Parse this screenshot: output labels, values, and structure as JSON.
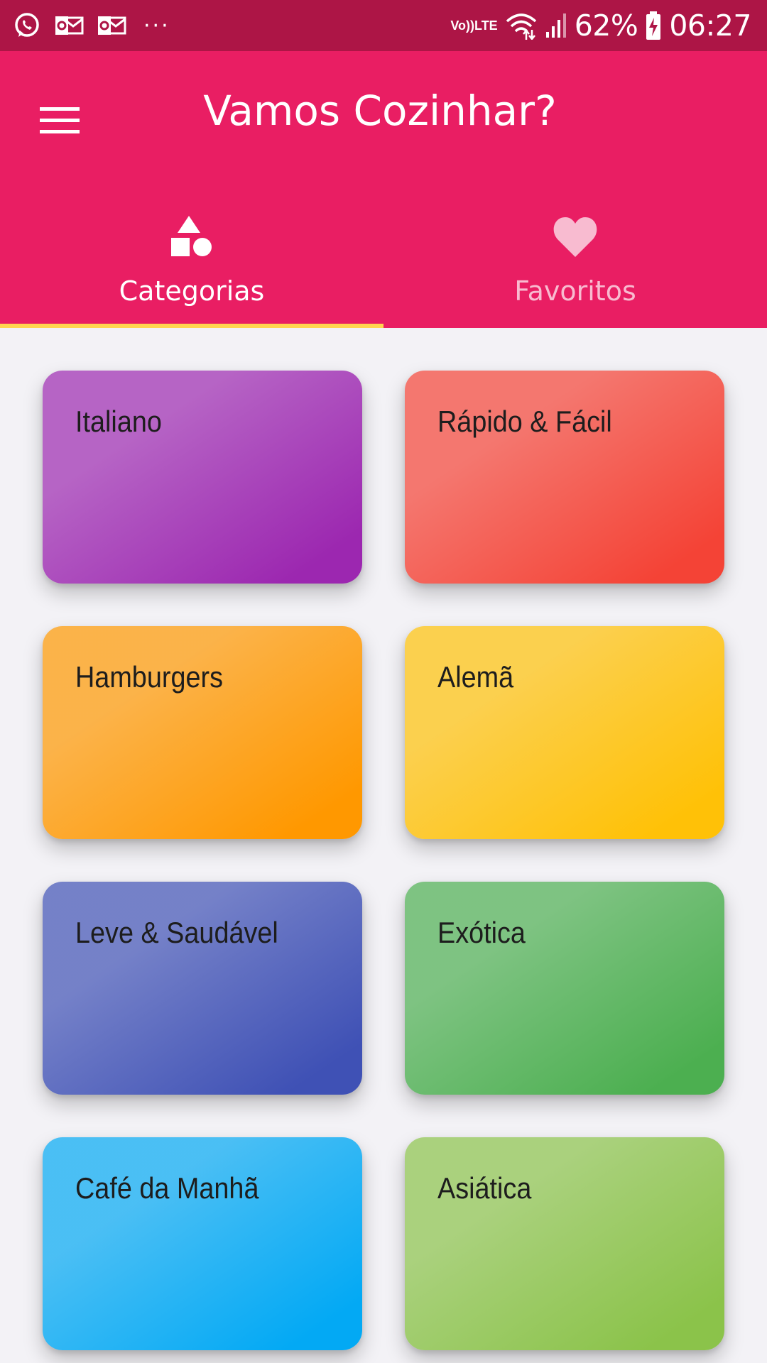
{
  "status_bar": {
    "battery": "62%",
    "time": "06:27",
    "volte_top": "Vo))",
    "volte_bottom": "LTE",
    "more": "···",
    "icons": [
      "whatsapp-icon",
      "outlook-icon",
      "outlook-icon",
      "volte-icon",
      "wifi-icon",
      "signal-icon",
      "battery-charging-icon"
    ]
  },
  "app_bar": {
    "title": "Vamos Cozinhar?",
    "menu_icon": "menu-icon",
    "background": "#e91e63"
  },
  "tabs": [
    {
      "label": "Categorias",
      "icon": "category-shapes-icon",
      "selected": true
    },
    {
      "label": "Favoritos",
      "icon": "heart-icon",
      "selected": false
    }
  ],
  "indicator_color": "#ffd54f",
  "categories": [
    {
      "label": "Italiano",
      "color": "#9c27b0"
    },
    {
      "label": "Rápido & Fácil",
      "color": "#f44336"
    },
    {
      "label": "Hamburgers",
      "color": "#ff9800"
    },
    {
      "label": "Alemã",
      "color": "#ffc107"
    },
    {
      "label": "Leve & Saudável",
      "color": "#3f51b5"
    },
    {
      "label": "Exótica",
      "color": "#4caf50"
    },
    {
      "label": "Café da Manhã",
      "color": "#03a9f4"
    },
    {
      "label": "Asiática",
      "color": "#8bc34a"
    }
  ]
}
